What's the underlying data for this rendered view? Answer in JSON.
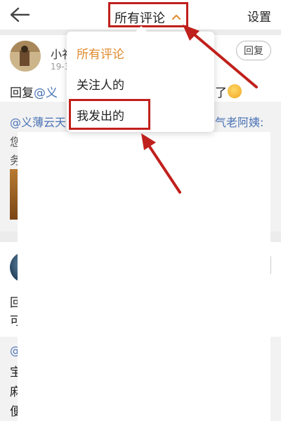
{
  "header": {
    "back_icon": "back-arrow-icon",
    "title": "所有评论",
    "caret_icon": "chevron-up-icon",
    "settings_label": "设置"
  },
  "feed": {
    "card1": {
      "username": "小祁",
      "time": "19-3",
      "reply_button": "回复",
      "reply_prefix": "回复",
      "reply_mention": "@义",
      "reply_tail": "了",
      "quote_mention": "@义薄云天",
      "quote_right": "气老阿姨:",
      "quote_line2": "您",
      "quote_line3": "务"
    },
    "card2": {
      "line1": "回",
      "line2": "可",
      "mention": "@",
      "line3": "宝",
      "line4": "麻",
      "line5": "便"
    }
  },
  "dropdown": {
    "items": [
      {
        "label": "所有评论",
        "active": true
      },
      {
        "label": "关注人的",
        "active": false
      },
      {
        "label": "我发出的",
        "active": false
      }
    ]
  },
  "colors": {
    "accent_orange": "#e08a2c",
    "annotation_red": "#c0201c",
    "mention_blue": "#4a73b5"
  }
}
